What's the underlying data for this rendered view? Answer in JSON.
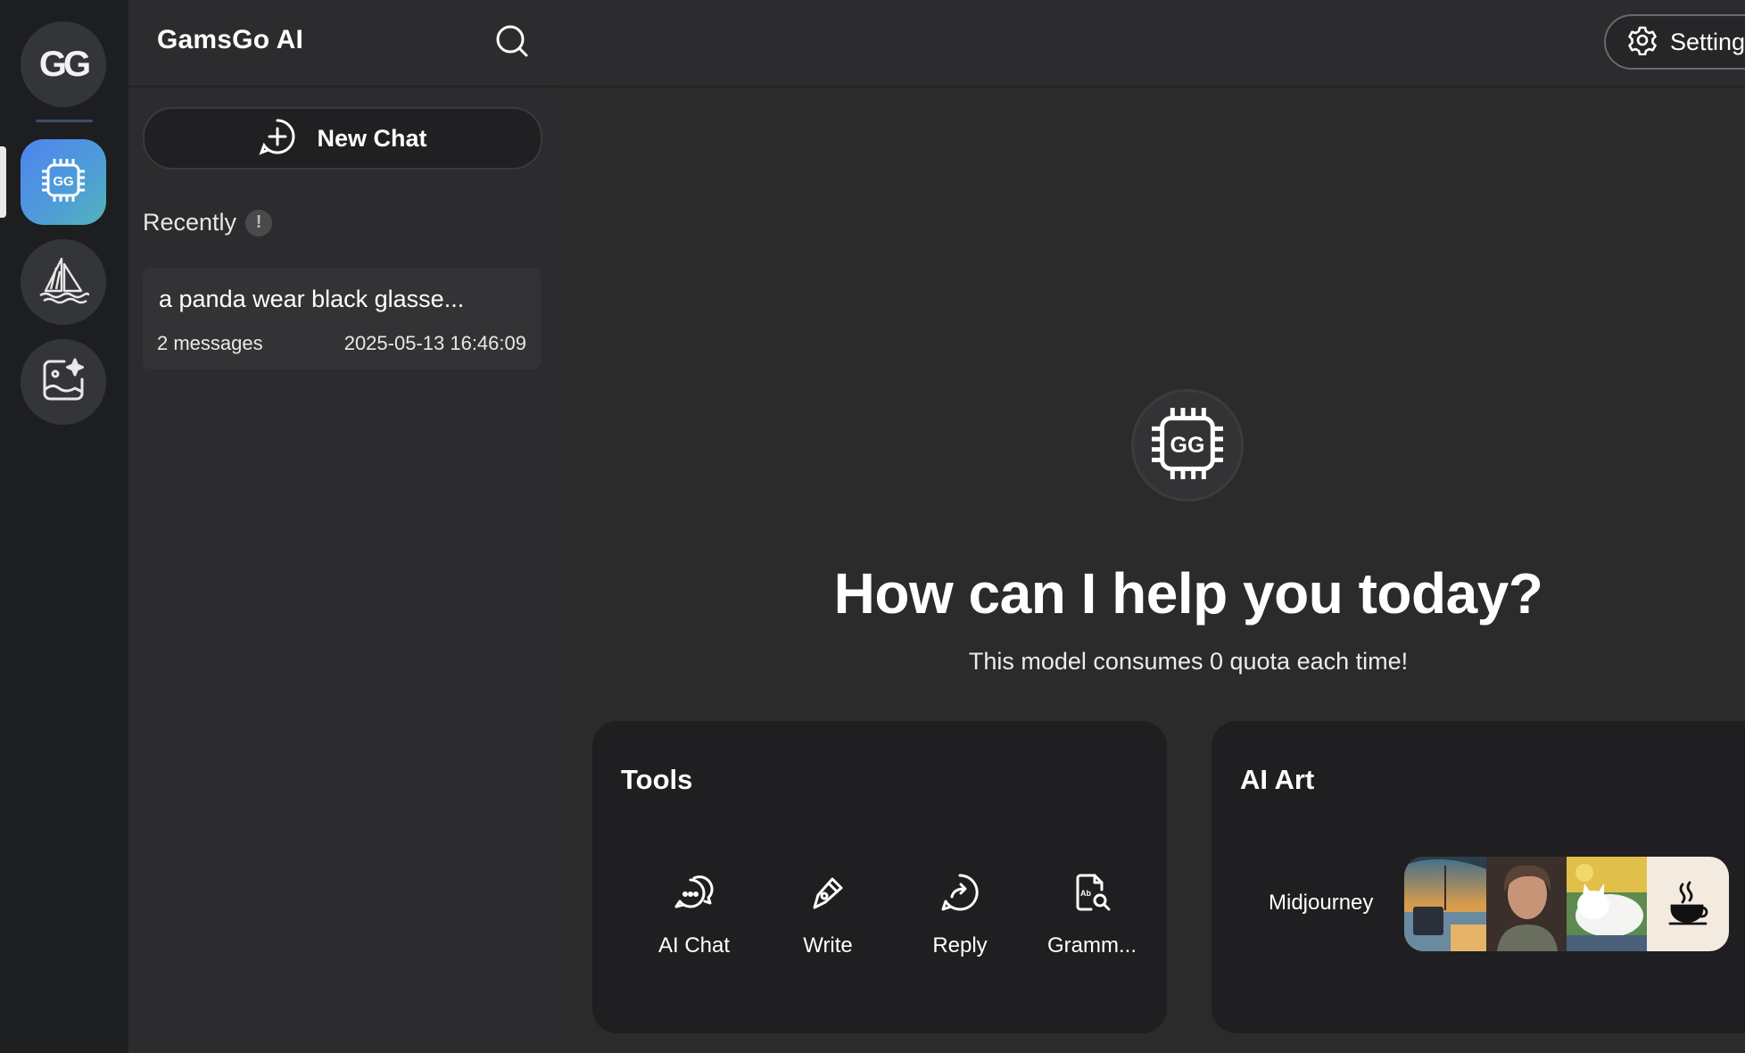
{
  "rail": {
    "logo_text": "GG",
    "items": [
      {
        "name": "ai-chat-app",
        "icon": "chip-gg-icon",
        "active": true
      },
      {
        "name": "midjourney-app",
        "icon": "sailboat-icon",
        "active": false
      },
      {
        "name": "ai-image-app",
        "icon": "image-sparkle-icon",
        "active": false
      }
    ]
  },
  "sidebar": {
    "title": "GamsGo AI",
    "search_icon": "search-icon",
    "new_chat_label": "New Chat",
    "recently_label": "Recently",
    "info_badge": "!",
    "chats": [
      {
        "title": "a panda wear black glasse...",
        "count": "2 messages",
        "time": "2025-05-13 16:46:09"
      }
    ]
  },
  "header": {
    "settings_label": "Settings"
  },
  "main": {
    "model_icon_text": "GG",
    "title": "How can I help you today?",
    "subtitle": "This model consumes 0 quota each time!"
  },
  "tools_card": {
    "title": "Tools",
    "items": [
      {
        "label": "AI Chat",
        "icon": "chat-bubbles-icon"
      },
      {
        "label": "Write",
        "icon": "pen-icon"
      },
      {
        "label": "Reply",
        "icon": "reply-icon"
      },
      {
        "label": "Gramm...",
        "icon": "grammar-doc-icon"
      }
    ]
  },
  "art_card": {
    "title": "AI Art",
    "midjourney_label": "Midjourney",
    "thumbnails": [
      "beach-sunset-image",
      "woman-portrait-image",
      "sleeping-cat-image",
      "coffee-cup-icon"
    ]
  },
  "colors": {
    "accent_gradient_start": "#4d84f0",
    "accent_gradient_end": "#53b3ba",
    "background": "#2b2b2c",
    "card": "#1f1f21"
  }
}
